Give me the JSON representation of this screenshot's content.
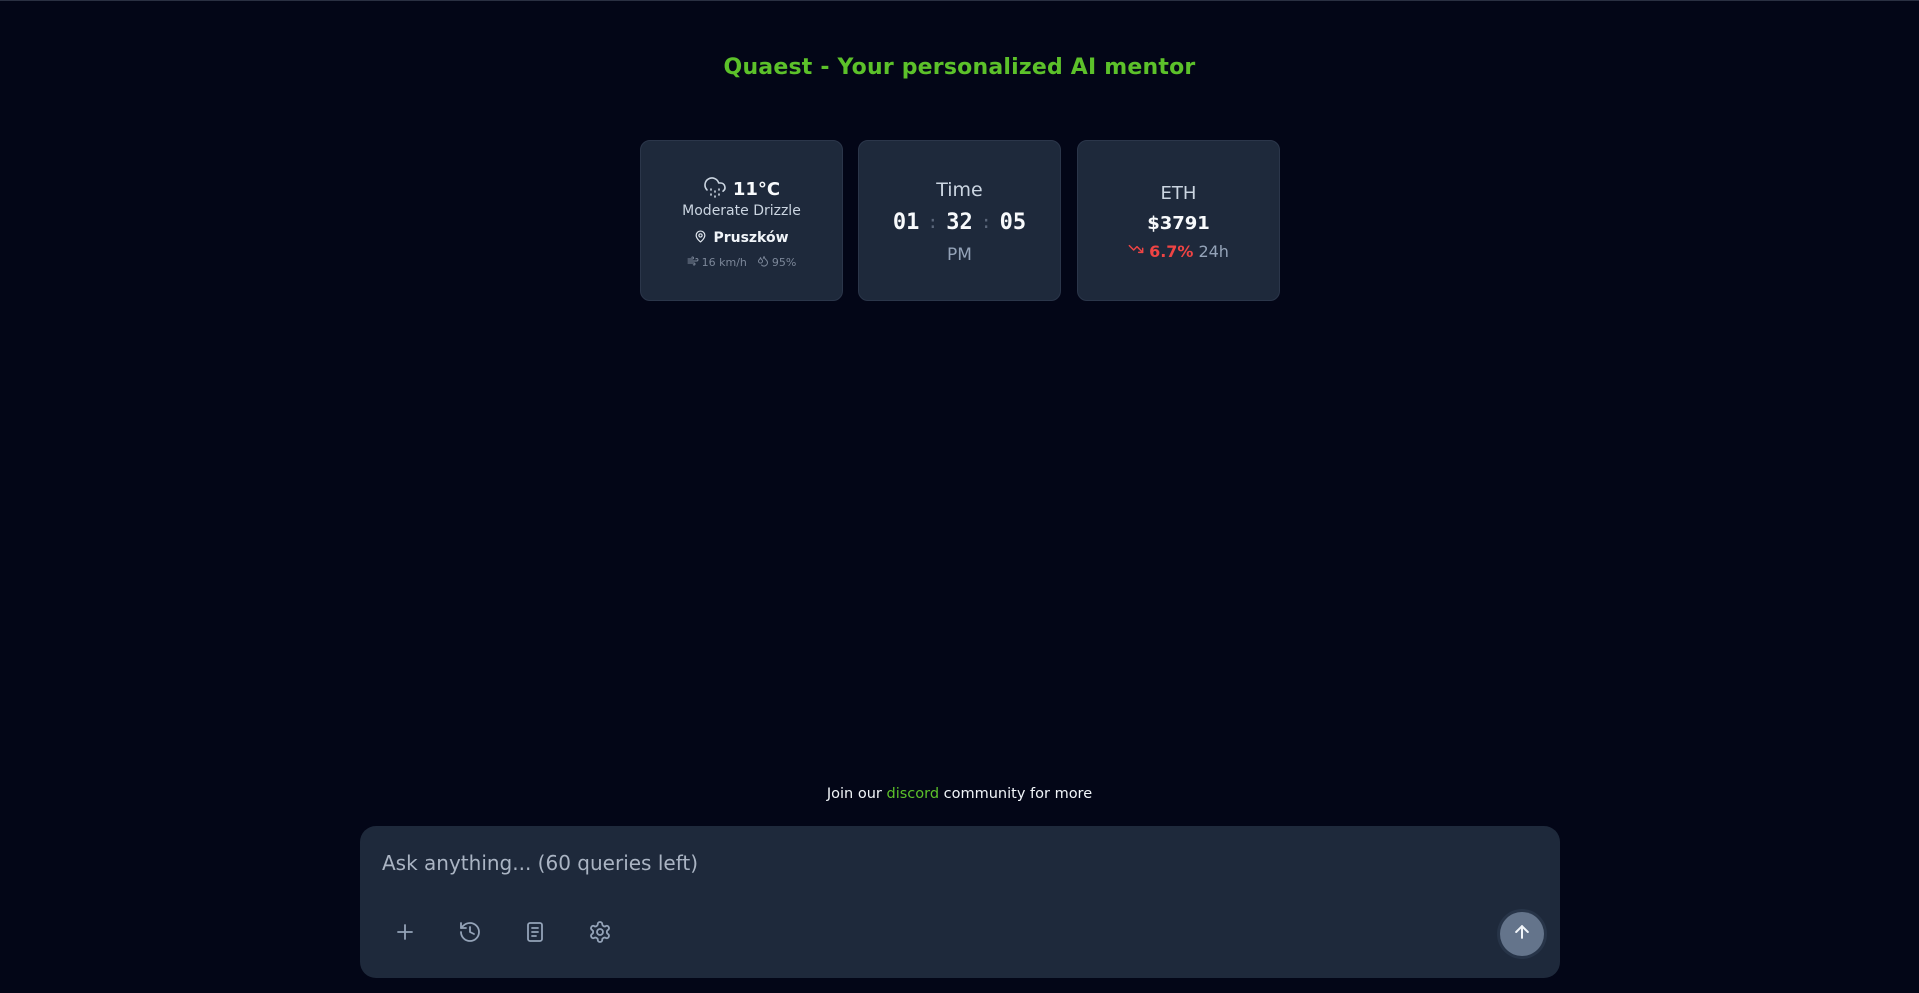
{
  "header": {
    "title": "Quaest - Your personalized AI mentor",
    "accent_color": "#5cc12a"
  },
  "weather": {
    "icon": "cloud-drizzle-icon",
    "temperature": "11°C",
    "condition": "Moderate Drizzle",
    "location": "Pruszków",
    "wind": "16 km/h",
    "humidity": "95%"
  },
  "time": {
    "label": "Time",
    "hours": "01",
    "minutes": "32",
    "seconds": "05",
    "separator": ":",
    "ampm": "PM"
  },
  "crypto": {
    "symbol": "ETH",
    "price": "$3791",
    "change": "6.7%",
    "change_direction": "down",
    "change_color": "#ef4444",
    "period": "24h"
  },
  "footer": {
    "prefix": "Join our ",
    "link": "discord",
    "suffix": " community for more"
  },
  "composer": {
    "placeholder": "Ask anything... (60 queries left)",
    "value": "",
    "tools": [
      "plus-icon",
      "history-icon",
      "book-icon",
      "settings-icon"
    ],
    "send_icon": "arrow-up-icon"
  }
}
